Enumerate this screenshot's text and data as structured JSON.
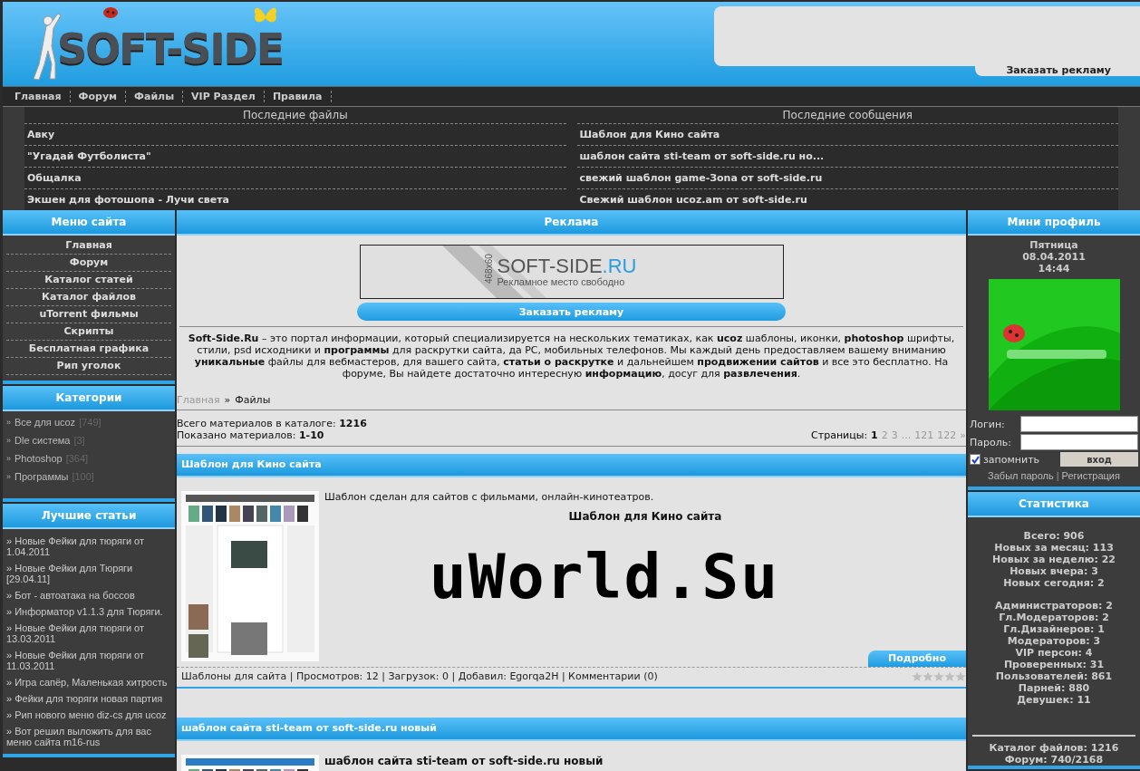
{
  "header": {
    "logo": "SOFT-SIDE",
    "ad_link": "Заказать рекламу"
  },
  "nav": [
    "Главная",
    "Форум",
    "Файлы",
    "VIP Раздел",
    "Правила"
  ],
  "latest": [
    {
      "title": "Последние файлы",
      "items": [
        "Авку",
        "\"Угадай Футболиста\"",
        "Общалка",
        "Экшен для фотошопа - Лучи света"
      ]
    },
    {
      "title": "Последние сообщения",
      "items": [
        "Шаблон для Кино сайта",
        "шаблон сайта sti-team от soft-side.ru но...",
        "свежий шаблон game-Зona от soft-side.ru",
        "Свежий шаблон ucoz.am от soft-side.ru"
      ]
    }
  ],
  "left": {
    "bullet": "»",
    "menu": {
      "title": "Меню сайта",
      "items": [
        "Главная",
        "Форум",
        "Каталог статей",
        "Каталог файлов",
        "uTorrent фильмы",
        "Скрипты",
        "Бесплатная графика",
        "Рип уголок"
      ]
    },
    "categories": {
      "title": "Категории",
      "items": [
        {
          "label": "Все для ucoz",
          "count": "[749]"
        },
        {
          "label": "Dle система",
          "count": "[3]"
        },
        {
          "label": "Photoshop",
          "count": "[364]"
        },
        {
          "label": "Программы",
          "count": "[100]"
        }
      ]
    },
    "best": {
      "title": "Лучшие статьи",
      "items": [
        "Новые Фейки для тюряги от 1.04.2011",
        "Новые Фейки для Тюряги [29.04.11]",
        "Бот - автоатака на боссов",
        "Информатор v1.1.3 для Тюряги.",
        "Новые Фейки для тюряги от 13.03.2011",
        "Новые Фейки для тюряги от 11.03.2011",
        "Игра сапёр, Маленькая хитрость",
        "Фейки для тюряги новая партия",
        "Рип нового меню diz-cs для ucoz",
        "Вот решил выложить для вас меню сайта m16-rus"
      ]
    }
  },
  "center": {
    "title": "Реклама",
    "banner": {
      "size": "468x60",
      "brand": "SOFT-SIDE",
      "domain": ".RU",
      "caption": "Рекламное место свободно"
    },
    "order_button": "Заказать рекламу",
    "intro": "**Soft-Side.Ru** – это портал информации, который специализируется на нескольких тематиках, как **ucoz** шаблоны, иконки, **photoshop** шрифты, стили, psd исходники и **программы** для раскрутки сайта, да PC, мобильных телефонов. Мы каждый день предоставляем вашему вниманию **уникальные** файлы для вебмастеров, для вашего сайта, **статьи о раскрутке** и дальнейшем **продвижении сайтов** и все это бесплатно. На форуме, Вы найдете достаточно интересную **информацию**, досуг для **развлечения**.",
    "breadcrumb": [
      "Главная",
      "»",
      "Файлы"
    ],
    "total": "Всего материалов в каталоге: **1216**",
    "shown": "Показано материалов: **1-10**",
    "pages_label": "Страницы:",
    "pages": [
      {
        "label": "1",
        "selected": true
      },
      {
        "label": "2",
        "selected": false
      },
      {
        "label": "3",
        "selected": false
      },
      {
        "label": "...",
        "selected": false
      },
      {
        "label": "121",
        "selected": false
      },
      {
        "label": "122",
        "selected": false
      },
      {
        "label": "»",
        "selected": false
      }
    ],
    "posts": [
      {
        "title": "Шаблон для Кино сайта",
        "description": "Шаблон сделан для сайтов с фильмами, онлайн-кинотеатров.",
        "heading": "Шаблон для Кино сайта",
        "banner_text": "uWorld.Su",
        "more": "Подробно",
        "meta": "Шаблоны для сайта | Просмотров: 12 | Загрузок: 0 | Добавил: Egorqa2H | Комментарии (0)",
        "stars": 0
      },
      {
        "title": "шаблон сайта sti-team от soft-side.ru новый",
        "heading": "шаблон сайта sti-team от soft-side.ru новый"
      }
    ]
  },
  "right": {
    "profile": {
      "title": "Мини профиль",
      "day": "Пятница",
      "date": "08.04.2011",
      "time": "14:44",
      "login_label": "Логин:",
      "password_label": "Пароль:",
      "remember": "запомнить",
      "remember_checked": true,
      "login_button": "вход",
      "forgot": "Забыл пароль",
      "separator": "|",
      "register": "Регистрация"
    },
    "stats": {
      "title": "Статистика",
      "groups": [
        [
          "Всего: 906",
          "Новых за месяц: 113",
          "Новых за неделю: 22",
          "Новых вчера: 3",
          "Новых сегодня: 2"
        ],
        [
          "Администраторов: 2",
          "Гл.Модераторов: 2",
          "Гл.Дизайнеров: 1",
          "Модераторов: 3",
          "VIP персон: 4",
          "Проверенных: 31",
          "Пользователей: 861",
          "Парней: 880",
          "Девушек: 11"
        ]
      ],
      "catalog": [
        "Каталог файлов: 1216",
        "Форум: 740/2168"
      ]
    }
  }
}
